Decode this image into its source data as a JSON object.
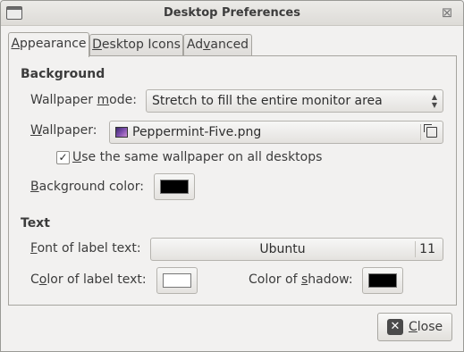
{
  "window": {
    "title": "Desktop Preferences"
  },
  "tabs": [
    {
      "pre": "",
      "u": "A",
      "post": "ppearance"
    },
    {
      "pre": "",
      "u": "D",
      "post": "esktop Icons"
    },
    {
      "pre": "Ad",
      "u": "v",
      "post": "anced"
    }
  ],
  "background": {
    "title": "Background",
    "wallpaper_mode_label": {
      "pre": "Wallpaper ",
      "u": "m",
      "post": "ode:"
    },
    "wallpaper_mode_value": "Stretch to fill the entire monitor area",
    "wallpaper_label": {
      "pre": "",
      "u": "W",
      "post": "allpaper:"
    },
    "wallpaper_file": "Peppermint-Five.png",
    "same_wallpaper": {
      "pre": "",
      "u": "U",
      "post": "se the same wallpaper on all desktops",
      "checked": "✓"
    },
    "bg_color_label": {
      "pre": "",
      "u": "B",
      "post": "ackground color:"
    },
    "bg_color": "#000000"
  },
  "text": {
    "title": "Text",
    "font_label": {
      "pre": "",
      "u": "F",
      "post": "ont of label text:"
    },
    "font_name": "Ubuntu",
    "font_size": "11",
    "label_color_label": {
      "pre": "C",
      "u": "o",
      "post": "lor of label text:"
    },
    "label_color": "#ffffff",
    "shadow_label": {
      "pre": "Color of ",
      "u": "s",
      "post": "hadow:"
    },
    "shadow_color": "#000000"
  },
  "footer": {
    "close": {
      "pre": "",
      "u": "C",
      "post": "lose"
    }
  }
}
